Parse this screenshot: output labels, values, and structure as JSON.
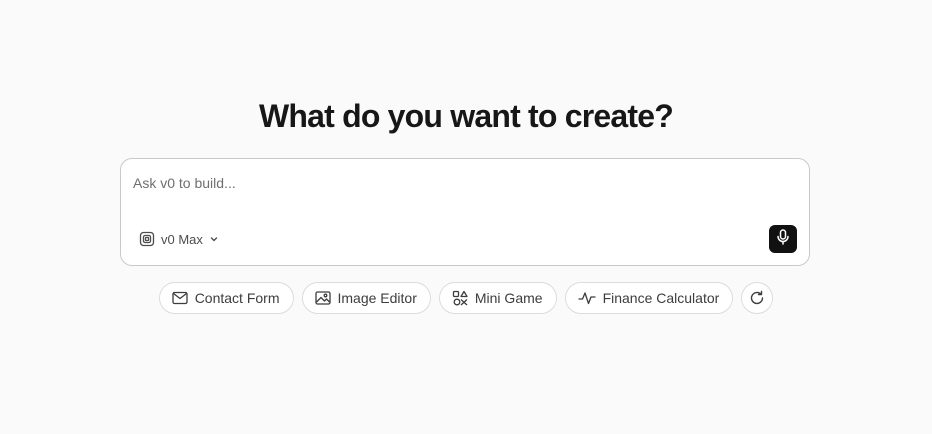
{
  "heading": "What do you want to create?",
  "prompt": {
    "placeholder": "Ask v0 to build...",
    "value": ""
  },
  "model_selector": {
    "label": "v0 Max",
    "icon": "model-icon"
  },
  "mic": {
    "icon": "microphone-icon"
  },
  "suggestions": [
    {
      "label": "Contact Form",
      "icon": "mail-icon"
    },
    {
      "label": "Image Editor",
      "icon": "image-icon"
    },
    {
      "label": "Mini Game",
      "icon": "shapes-icon"
    },
    {
      "label": "Finance Calculator",
      "icon": "pulse-icon"
    }
  ],
  "refresh": {
    "icon": "refresh-icon"
  },
  "colors": {
    "background": "#fafafa",
    "mic_button": "#111111",
    "border": "#c9c9c9"
  }
}
